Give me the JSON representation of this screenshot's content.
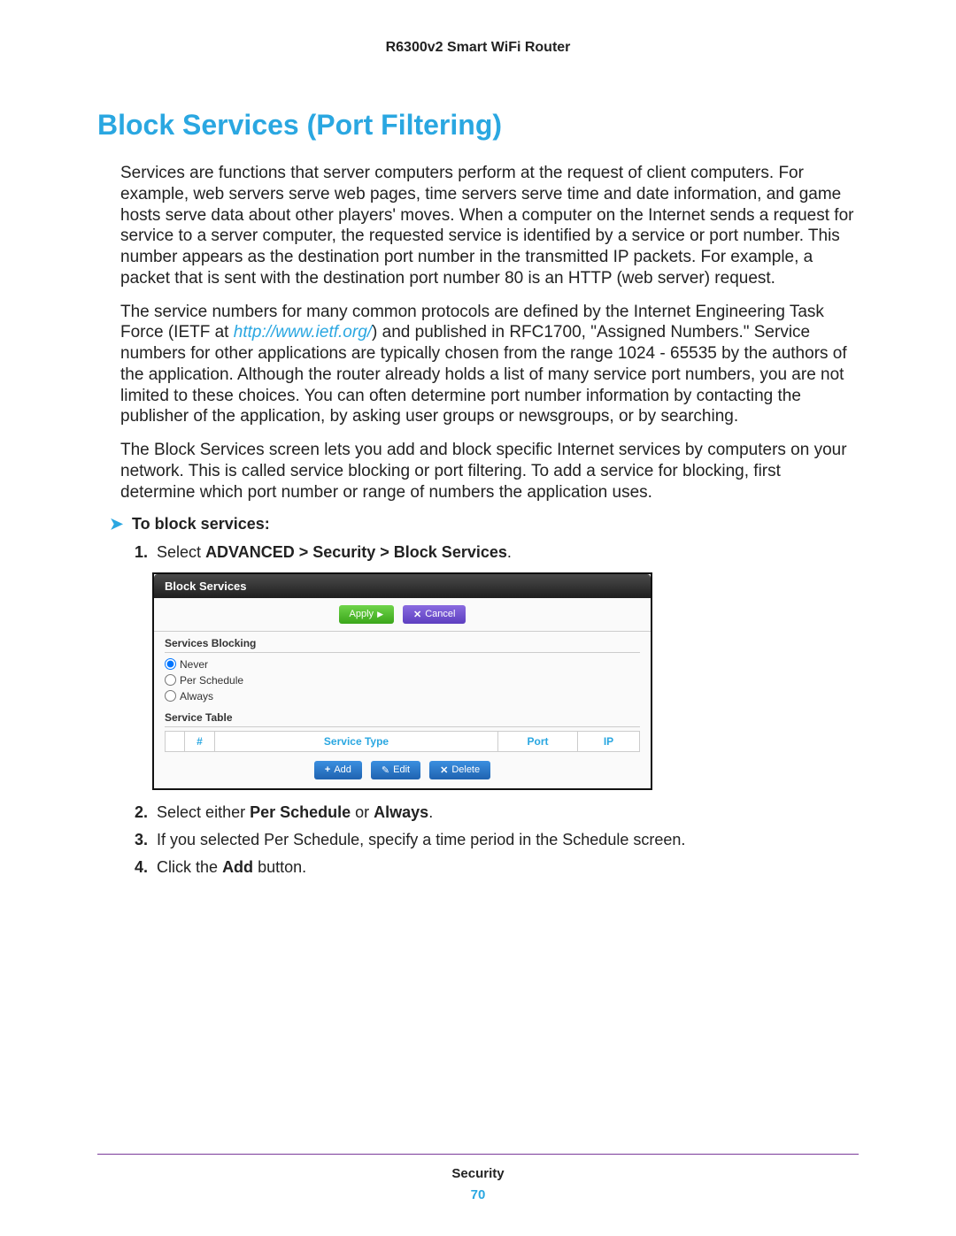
{
  "doc_header": "R6300v2 Smart WiFi Router",
  "heading": "Block Services (Port Filtering)",
  "para1": "Services are functions that server computers perform at the request of client computers. For example, web servers serve web pages, time servers serve time and date information, and game hosts serve data about other players' moves. When a computer on the Internet sends a request for service to a server computer, the requested service is identified by a service or port number. This number appears as the destination port number in the transmitted IP packets. For example, a packet that is sent with the destination port number 80 is an HTTP (web server) request.",
  "para2a": "The service numbers for many common protocols are defined by the Internet Engineering Task Force (IETF at ",
  "para2_link": "http://www.ietf.org/",
  "para2b": ") and published in RFC1700, \"Assigned Numbers.\" Service numbers for other applications are typically chosen from the range 1024 - 65535 by the authors of the application. Although the router already holds a list of many service port numbers, you are not limited to these choices. You can often determine port number information by contacting the publisher of the application, by asking user groups or newsgroups, or by searching.",
  "para3": "The Block Services screen lets you add and block specific Internet services by computers on your network. This is called service blocking or port filtering. To add a service for blocking, first determine which port number or range of numbers the application uses.",
  "proc_arrow": "➤",
  "proc_label": "To block services:",
  "steps": {
    "s1a": "1.",
    "s1b": "Select ",
    "s1c": "ADVANCED > Security > Block Services",
    "s1d": ".",
    "s2a": "2.",
    "s2b": "Select either ",
    "s2c": "Per Schedule",
    "s2d": " or ",
    "s2e": "Always",
    "s2f": ".",
    "s3a": "3.",
    "s3b": "If you selected Per Schedule, specify a time period in the Schedule screen.",
    "s4a": "4.",
    "s4b": "Click the ",
    "s4c": "Add",
    "s4d": " button."
  },
  "shot": {
    "title": "Block Services",
    "apply": "Apply",
    "cancel": "Cancel",
    "sec_blocking": "Services Blocking",
    "opt_never": "Never",
    "opt_schedule": "Per Schedule",
    "opt_always": "Always",
    "service_table": "Service Table",
    "col_hash": "#",
    "col_type": "Service Type",
    "col_port": "Port",
    "col_ip": "IP",
    "add": "Add",
    "edit": "Edit",
    "delete": "Delete"
  },
  "footer_section": "Security",
  "footer_page": "70"
}
